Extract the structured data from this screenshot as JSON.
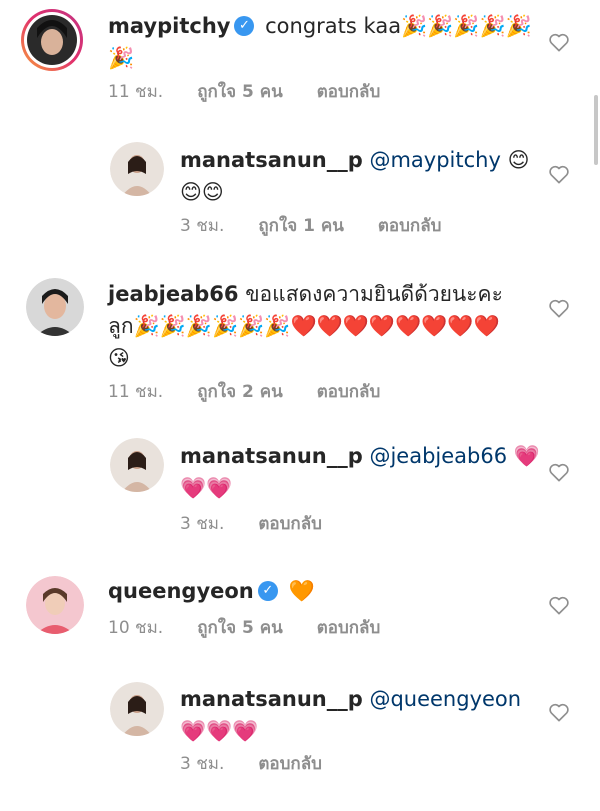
{
  "comments": [
    {
      "username": "maypitchy",
      "verified": true,
      "text": "congrats kaa",
      "emoji": "🎉🎉🎉🎉🎉🎉",
      "time": "11 ชม.",
      "likes": "ถูกใจ 5 คน",
      "reply": "ตอบกลับ"
    },
    {
      "username": "manatsanun__p",
      "mention": "@maypitchy",
      "emoji": "😊😊😊",
      "time": "3 ชม.",
      "likes": "ถูกใจ 1 คน",
      "reply": "ตอบกลับ"
    },
    {
      "username": "jeabjeab66",
      "text": "ขอแสดงความยินดีด้วยนะคะ ลูก",
      "emoji": "🎉🎉🎉🎉🎉🎉❤️❤️❤️❤️❤️❤️❤️❤️😘",
      "time": "11 ชม.",
      "likes": "ถูกใจ 2 คน",
      "reply": "ตอบกลับ"
    },
    {
      "username": "manatsanun__p",
      "mention": "@jeabjeab66",
      "emoji": "💗💗💗",
      "time": "3 ชม.",
      "reply": "ตอบกลับ"
    },
    {
      "username": "queengyeon",
      "verified": true,
      "emoji": "🧡",
      "time": "10 ชม.",
      "likes": "ถูกใจ 5 คน",
      "reply": "ตอบกลับ"
    },
    {
      "username": "manatsanun__p",
      "mention": "@queengyeon",
      "emoji": "💗💗💗",
      "time": "3 ชม.",
      "reply": "ตอบกลับ"
    }
  ],
  "icons": {
    "like": "heart-outline-icon",
    "verified": "verified-badge-icon"
  },
  "colors": {
    "mention": "#00376b",
    "verified": "#3897f0",
    "meta": "#8e8e8e"
  }
}
